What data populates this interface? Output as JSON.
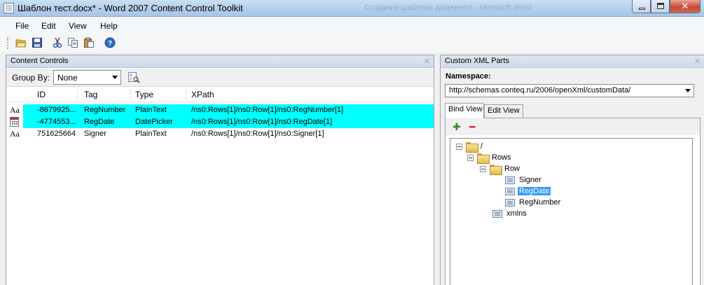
{
  "window": {
    "title": "Шаблон тест.docx* - Word 2007 Content Control Toolkit",
    "ghost_title": "Создание шаблона документа - Microsoft Word"
  },
  "menu": [
    "File",
    "Edit",
    "View",
    "Help"
  ],
  "toolbar": {
    "icons": [
      "open-folder-icon",
      "save-icon",
      "cut-icon",
      "copy-icon",
      "paste-icon",
      "help-icon"
    ]
  },
  "content_controls": {
    "title": "Content Controls",
    "group_by_label": "Group By:",
    "group_by_value": "None",
    "columns": [
      "ID",
      "Tag",
      "Type",
      "XPath"
    ],
    "rows": [
      {
        "icon": "Aa",
        "id": "-8679925...",
        "tag": "RegNumber",
        "type": "PlainText",
        "xpath": "/ns0:Rows[1]/ns0:Row[1]/ns0:RegNumber[1]",
        "selected": true
      },
      {
        "icon": "calendar-icon",
        "id": "-4774553...",
        "tag": "RegDate",
        "type": "DatePicker",
        "xpath": "/ns0:Rows[1]/ns0:Row[1]/ns0:RegDate[1]",
        "selected": true
      },
      {
        "icon": "Aa",
        "id": "751625664",
        "tag": "Signer",
        "type": "PlainText",
        "xpath": "/ns0:Rows[1]/ns0:Row[1]/ns0:Signer[1]",
        "selected": false
      }
    ]
  },
  "custom_xml": {
    "title": "Custom XML Parts",
    "namespace_label": "Namespace:",
    "namespace_value": "http://schemas.conteq.ru/2006/openXml/customData/",
    "tabs": [
      "Bind View",
      "Edit View"
    ],
    "active_tab": "Bind View",
    "tree": {
      "root": "/",
      "rows": "Rows",
      "row": "Row",
      "signer": "Signer",
      "regdate": "RegDate",
      "regnumber": "RegNumber",
      "xmlns": "xmlns"
    },
    "selected_node": "RegDate"
  },
  "colors": {
    "selection": "#00ffff",
    "tree_selection": "#3399ff"
  }
}
